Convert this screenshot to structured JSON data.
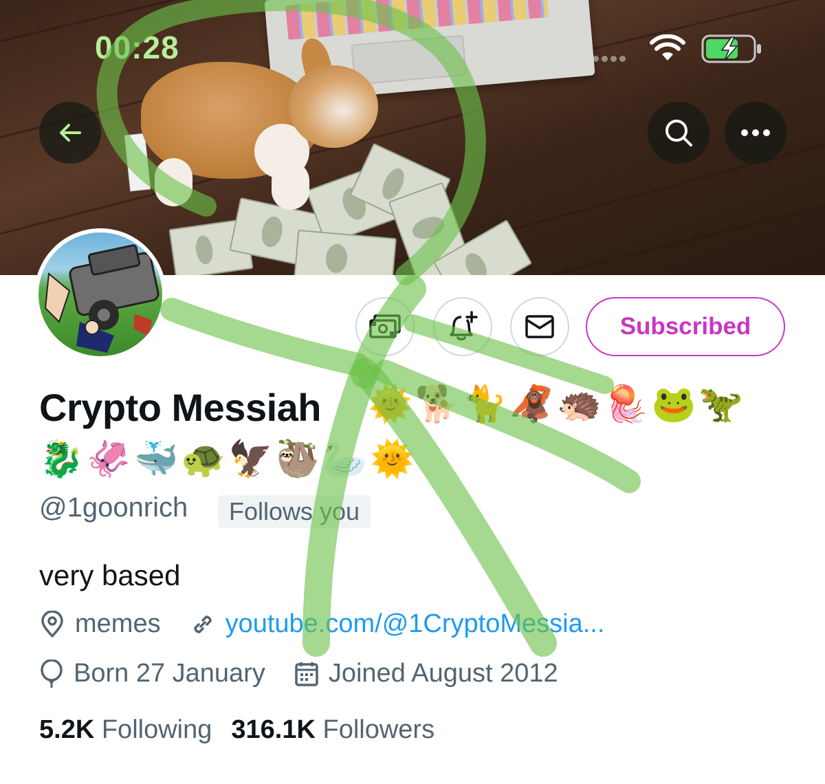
{
  "status_bar": {
    "time": "00:28"
  },
  "header": {
    "back_icon": "arrow-left-icon",
    "search_icon": "search-icon",
    "more_icon": "more-horizontal-icon"
  },
  "actions": {
    "tip_icon": "money-icon",
    "notify_icon": "bell-plus-icon",
    "message_icon": "envelope-icon",
    "subscribed_label": "Subscribed"
  },
  "profile": {
    "display_name": "Crypto Messiah",
    "name_emojis_line1": "🌞🐕🐈🦧🦔🪼🐸🦖",
    "name_emojis_line2": "🐉🦑🐳🐢🦅🦥🦢🌞",
    "handle": "@1goonrich",
    "follows_you": "Follows you",
    "bio": "very based",
    "location": "memes",
    "website": "youtube.com/@1CryptoMessia...",
    "birthday": "Born 27 January",
    "joined": "Joined August 2012",
    "following_count": "5.2K",
    "following_label": "Following",
    "followers_count": "316.1K",
    "followers_label": "Followers"
  },
  "colors": {
    "subscribed_accent": "#c936c5",
    "link": "#1d9bf0",
    "secondary_text": "#536471",
    "markup_green": "#6cc24a"
  }
}
